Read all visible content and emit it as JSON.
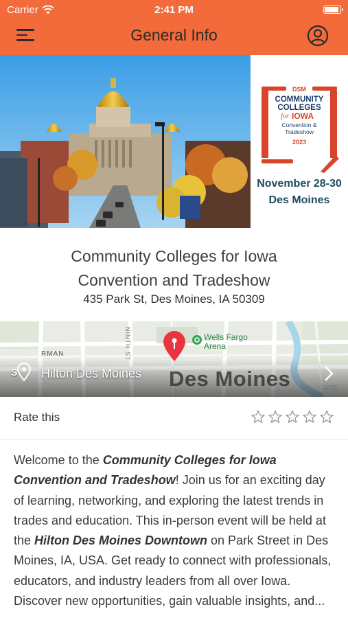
{
  "status_bar": {
    "carrier": "Carrier",
    "time": "2:41 PM"
  },
  "nav": {
    "title": "General Info",
    "menu_icon": "hamburger-menu-icon",
    "profile_icon": "user-circle-icon"
  },
  "hero": {
    "logo": {
      "line1": "DSM",
      "line2": "COMMUNITY",
      "line3": "COLLEGES",
      "line4": "for",
      "line5": "IOWA",
      "line6": "Convention &",
      "line7": "Tradeshow",
      "line8": "2023"
    },
    "dates": "November 28-30",
    "city": "Des Moines"
  },
  "event": {
    "title_line1": "Community Colleges for Iowa",
    "title_line2": "Convention and Tradeshow",
    "address": "435 Park St, Des Moines, IA 50309"
  },
  "map": {
    "place_name": "Hilton Des Moines",
    "city_label": "Des Moines",
    "arena_label_line1": "Wells Fargo",
    "arena_label_line2": "Arena",
    "street_label": "NINTH ST",
    "legal": "Legal",
    "fragment_label": "S",
    "fragment_label2": "RMAN"
  },
  "rating": {
    "label": "Rate this",
    "max_stars": 5,
    "current": 0
  },
  "description": {
    "p1": "Welcome to the ",
    "b1": "Community Colleges for Iowa Convention and Tradeshow",
    "p2": "! Join us for an exciting day of learning, networking, and exploring the latest trends in trades and education. This in-person event will be held at the ",
    "b2": "Hilton Des Moines Downtown",
    "p3": " on Park Street in Des Moines, IA, USA. Get ready to connect with professionals, educators, and industry leaders from all over Iowa. Discover new opportunities, ",
    "p4": "gain valuable insights, and..."
  },
  "colors": {
    "accent": "#f36a3b",
    "logo_red": "#d9452b",
    "date_blue": "#1e4a5f"
  }
}
